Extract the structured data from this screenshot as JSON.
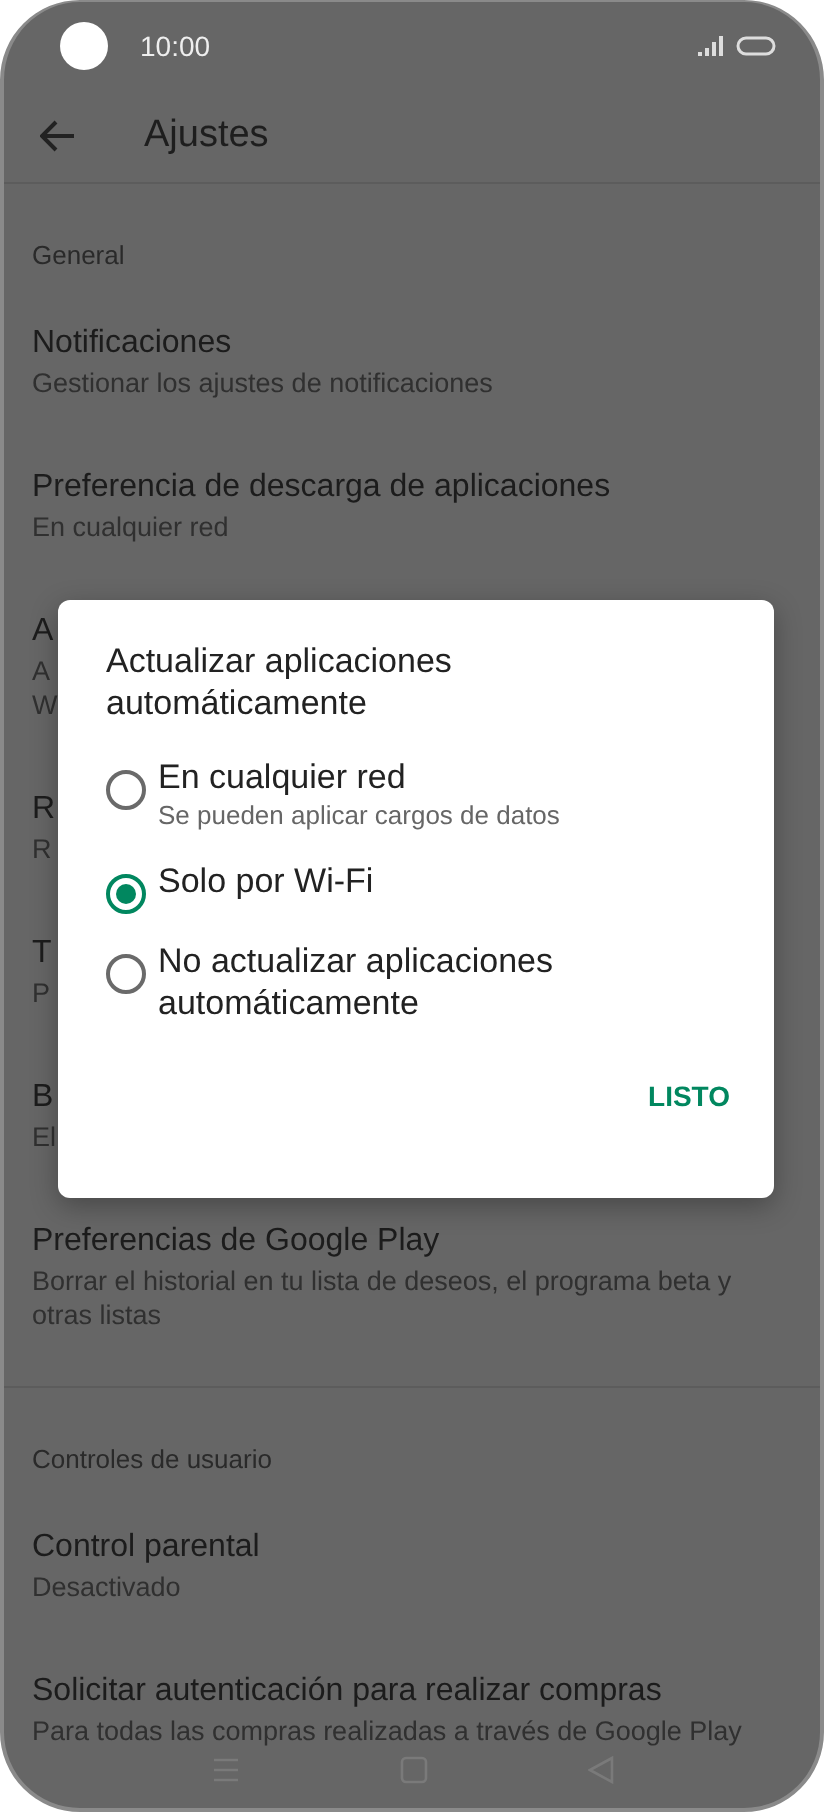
{
  "status_bar": {
    "time": "10:00"
  },
  "header": {
    "title": "Ajustes"
  },
  "sections": [
    {
      "heading": "General",
      "items": [
        {
          "title": "Notificaciones",
          "subtitle": [
            "Gestionar los ajustes de notificaciones"
          ]
        },
        {
          "title": "Preferencia de descarga de aplicaciones",
          "subtitle": [
            "En cualquier red"
          ]
        },
        {
          "title": "A",
          "subtitle": [
            "A",
            "W"
          ]
        },
        {
          "title": "R",
          "subtitle": [
            "R"
          ]
        },
        {
          "title": "T",
          "subtitle": [
            "P"
          ]
        },
        {
          "title": "B",
          "subtitle": [
            "El"
          ]
        },
        {
          "title": "Preferencias de Google Play",
          "subtitle": [
            "Borrar el historial en tu lista de deseos, el programa beta y otras listas"
          ]
        }
      ]
    },
    {
      "heading": "Controles de usuario",
      "items": [
        {
          "title": "Control parental",
          "subtitle": [
            "Desactivado"
          ]
        },
        {
          "title": "Solicitar autenticación para realizar compras",
          "subtitle": [
            "Para todas las compras realizadas a través de Google Play"
          ]
        }
      ]
    }
  ],
  "dialog": {
    "title": "Actualizar aplicaciones automáticamente",
    "options": [
      {
        "label": "En cualquier red",
        "sublabel": "Se pueden aplicar cargos de datos",
        "selected": false
      },
      {
        "label": "Solo por Wi-Fi",
        "selected": true
      },
      {
        "label": "No actualizar aplicaciones automáticamente",
        "selected": false
      }
    ],
    "button": "LISTO"
  }
}
